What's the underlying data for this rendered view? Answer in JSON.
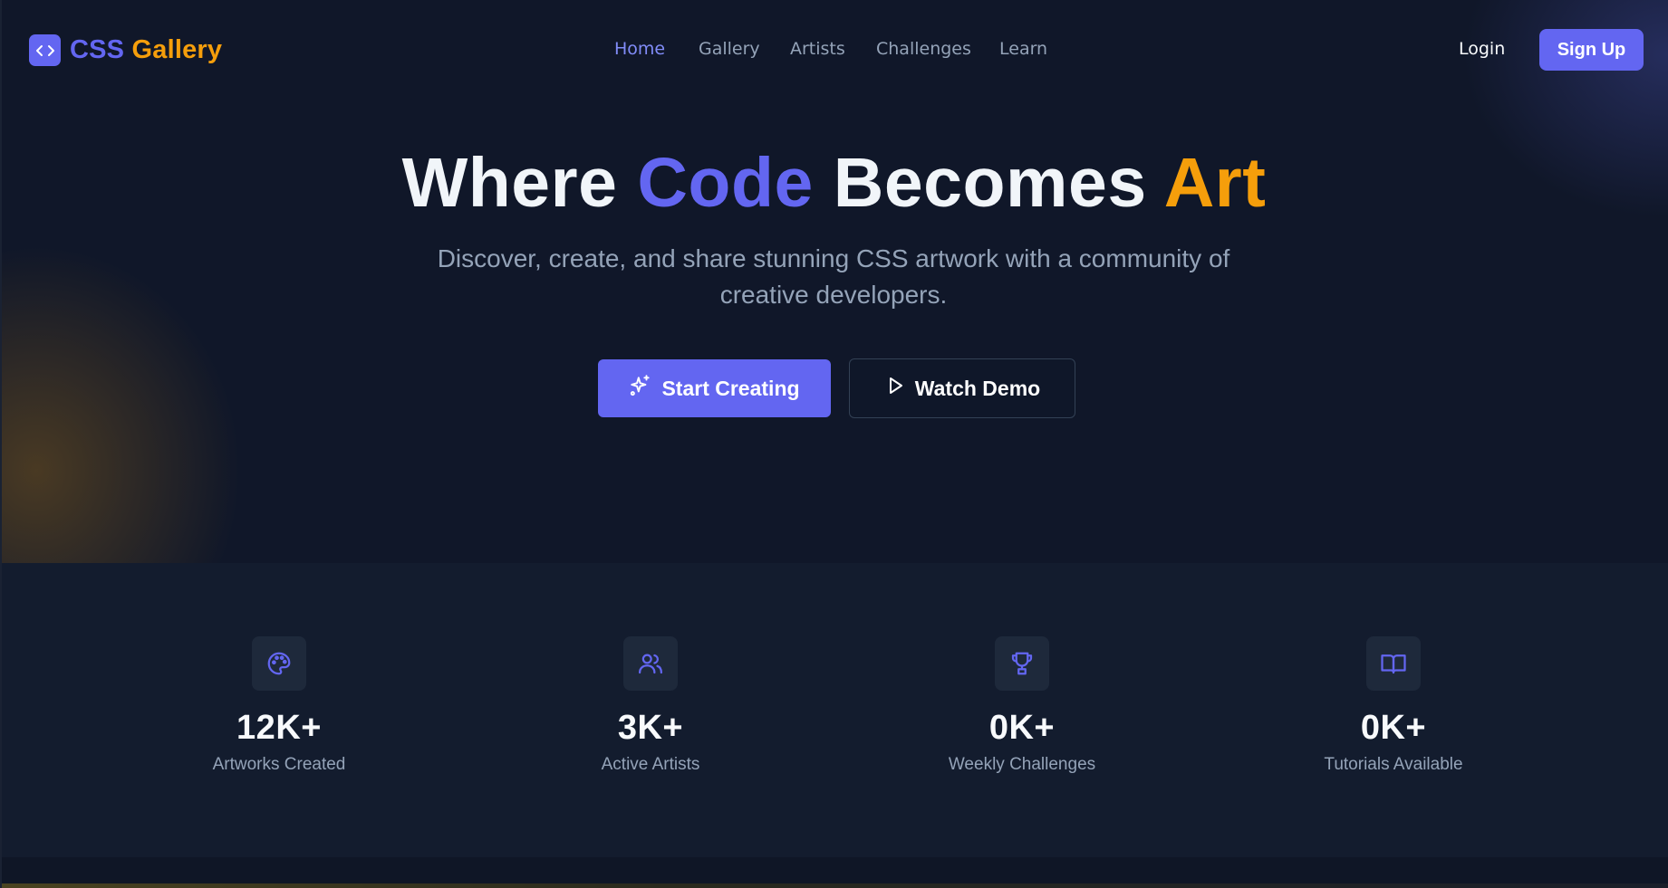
{
  "brand": {
    "name_part1": "CSS",
    "name_part2": "Gallery",
    "icon": "code-icon",
    "colors": {
      "primary": "#6366f1",
      "accent": "#f59e0b",
      "background": "#101729"
    }
  },
  "nav": {
    "items": [
      {
        "label": "Home",
        "active": true
      },
      {
        "label": "Gallery",
        "active": false
      },
      {
        "label": "Artists",
        "active": false
      },
      {
        "label": "Challenges",
        "active": false
      },
      {
        "label": "Learn",
        "active": false
      }
    ]
  },
  "auth": {
    "login_label": "Login",
    "signup_label": "Sign Up"
  },
  "hero": {
    "headline": {
      "part1": "Where",
      "part2": "Code",
      "part3": "Becomes",
      "part4": "Art"
    },
    "subtitle": "Discover, create, and share stunning CSS artwork with a community of creative developers.",
    "primary_cta": {
      "label": "Start Creating",
      "icon": "sparkles-icon"
    },
    "secondary_cta": {
      "label": "Watch Demo",
      "icon": "play-icon"
    }
  },
  "stats": [
    {
      "value": "12K+",
      "label": "Artworks Created",
      "icon": "palette-icon"
    },
    {
      "value": "3K+",
      "label": "Active Artists",
      "icon": "users-icon"
    },
    {
      "value": "0K+",
      "label": "Weekly Challenges",
      "icon": "trophy-icon"
    },
    {
      "value": "0K+",
      "label": "Tutorials Available",
      "icon": "book-open-icon"
    }
  ]
}
